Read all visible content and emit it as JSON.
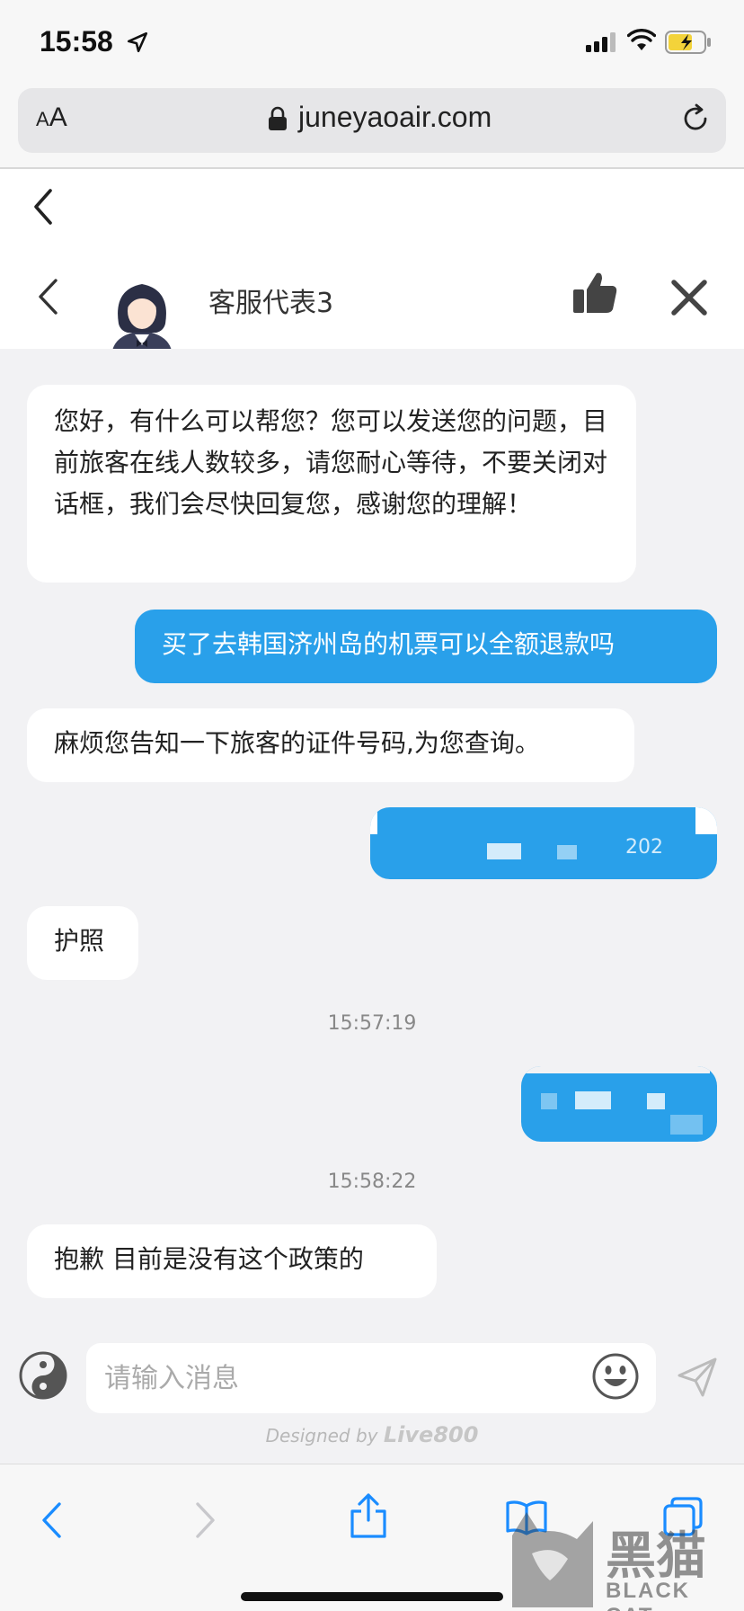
{
  "status_bar": {
    "time": "15:58"
  },
  "browser": {
    "aa_label_small": "A",
    "aa_label_large": "A",
    "url": "juneyaoair.com"
  },
  "chat": {
    "agent_name": "客服代表3",
    "messages": [
      {
        "side": "left",
        "text": "您好，有什么可以帮您？您可以发送您的问题，目前旅客在线人数较多，请您耐心等待，不要关闭对话框，我们会尽快回复您，感谢您的理解！"
      },
      {
        "side": "right",
        "text": "买了去韩国济州岛的机票可以全额退款吗"
      },
      {
        "side": "left",
        "text": "麻烦您告知一下旅客的证件号码,为您查询。"
      },
      {
        "side": "right",
        "text": "202"
      },
      {
        "side": "left",
        "text": "护照"
      },
      {
        "side": "time",
        "text": "15:57:19"
      },
      {
        "side": "right",
        "text": ""
      },
      {
        "side": "time",
        "text": "15:58:22"
      },
      {
        "side": "left",
        "text": "抱歉 目前是没有这个政策的"
      }
    ],
    "input_placeholder": "请输入消息",
    "designed_by": "Designed by",
    "designed_brand": "Live800"
  },
  "watermark": {
    "text": "黑猫",
    "sub": "BLACK CAT"
  },
  "colors": {
    "accent": "#29a0ea",
    "ios_blue": "#1a8cff"
  }
}
